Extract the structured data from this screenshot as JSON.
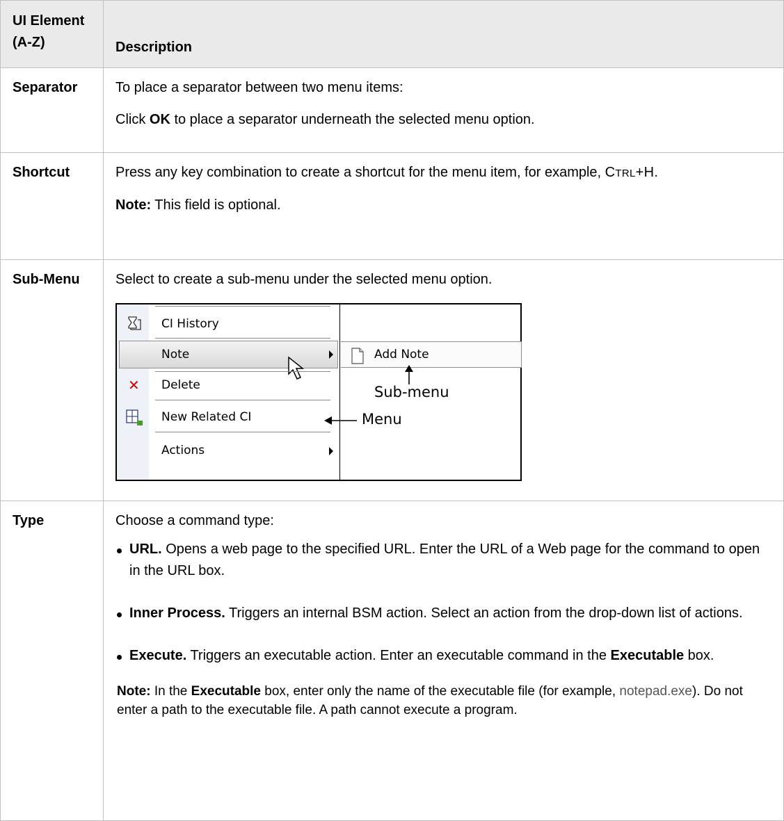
{
  "header": {
    "col1": "UI Element (A-Z)",
    "col2": "Description"
  },
  "rows": {
    "separator": {
      "name": "Separator",
      "line1": "To place a separator between two menu items:",
      "line2_pre": "Click ",
      "line2_bold": "OK",
      "line2_post": " to place a separator underneath the selected menu option."
    },
    "shortcut": {
      "name": "Shortcut",
      "line1": "Press any key combination to create a shortcut for the menu item, for example,",
      "key_c": "C",
      "key_trl": "TRL",
      "key_rest": "+H.",
      "note_label": "Note:",
      "note_text": " This field is optional."
    },
    "submenu": {
      "name": "Sub-Menu",
      "line1": "Select to create a sub-menu under the selected menu option.",
      "screenshot": {
        "items": [
          "CI History",
          "Note",
          "Delete",
          "New Related CI",
          "Actions"
        ],
        "sub_item": "Add Note",
        "callout_submenu": "Sub-menu",
        "callout_menu": "Menu"
      }
    },
    "type": {
      "name": "Type",
      "intro": "Choose a command type:",
      "bullets": [
        {
          "bold": "URL.",
          "text": " Opens a web page to the specified URL. Enter the URL of a Web page for the command to open in the URL box."
        },
        {
          "bold": "Inner Process.",
          "text": " Triggers an internal BSM action. Select an action from the drop-down list of actions."
        },
        {
          "bold": "Execute.",
          "text": " Triggers an executable action. Enter an executable command in the ",
          "bold2": "Executable",
          "text2": " box."
        }
      ],
      "note": {
        "label": "Note:",
        "t1": " In the ",
        "b1": "Executable",
        "t2": " box, enter only the name of the executable file (for example, ",
        "code": "notepad.exe",
        "t3": "). Do not enter a path to the executable file. A path cannot execute a program."
      }
    }
  }
}
